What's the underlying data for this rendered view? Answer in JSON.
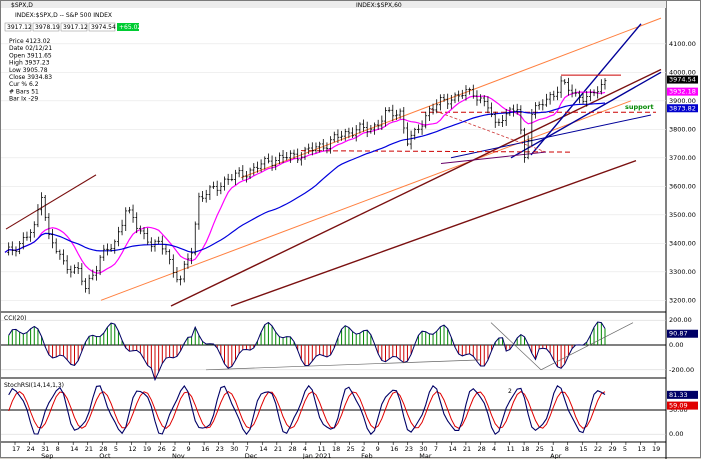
{
  "window": {
    "tab_left": "$SPX,D",
    "tab_right": "INDEX:$SPX,60",
    "title": "INDEX:$SPX,D  --  S&P 500 INDEX"
  },
  "ohlc_bar": {
    "open": "3917.12",
    "high": "3978.19",
    "low": "3917.12",
    "close": "3974.54",
    "change": "+65.02"
  },
  "data_window": [
    "Price   4123.02",
    "Date    02/12/21",
    "Open    3911.65",
    "High    3937.23",
    "Low     3905.78",
    "Close   3934.83",
    "Cur %  6.2",
    "# Bars 51",
    "Bar Ix  -29"
  ],
  "annotations": {
    "support": "support",
    "wave_label": "2"
  },
  "price_scale": {
    "ticks": [
      "4100.00",
      "4000.00",
      "3900.00",
      "3800.00",
      "3700.00",
      "3600.00",
      "3500.00",
      "3400.00",
      "3300.00",
      "3200.00"
    ],
    "badges": [
      {
        "text": "3974.54",
        "bg": "#000000",
        "fg": "#ffffff"
      },
      {
        "text": "3932.18",
        "bg": "#ff00ff",
        "fg": "#ffffff"
      },
      {
        "text": "3873.82",
        "bg": "#0000cc",
        "fg": "#ffffff"
      }
    ]
  },
  "cci_panel": {
    "title": "CCI(20)",
    "ticks": [
      "200.00",
      "0.00",
      "-200.00"
    ],
    "badge": {
      "text": "90.87",
      "bg": "#000066",
      "fg": "#ffffff"
    }
  },
  "stoch_panel": {
    "title": "StochRSI(14,14,1,3)",
    "ticks": [
      "50.00",
      "0.00"
    ],
    "badges": [
      {
        "text": "81.33",
        "bg": "#000066",
        "fg": "#ffffff"
      },
      {
        "text": "59.09",
        "bg": "#e00000",
        "fg": "#ffffff"
      }
    ]
  },
  "x_axis": {
    "ticks": [
      "17",
      "24",
      "31",
      "8",
      "14",
      "21",
      "28",
      "5",
      "12",
      "19",
      "26",
      "2",
      "9",
      "16",
      "23",
      "30",
      "7",
      "14",
      "21",
      "28",
      "4",
      "11",
      "18",
      "25",
      "2",
      "9",
      "16",
      "23",
      "30",
      "7",
      "14",
      "21",
      "28",
      "4",
      "11",
      "18",
      "25",
      "1",
      "8",
      "15",
      "22",
      "29",
      "5",
      "13",
      "19"
    ],
    "months": [
      "Sep",
      "Oct",
      "Nov",
      "Dec",
      "Jan 2021",
      "Feb",
      "Mar",
      "Apr"
    ]
  },
  "chart_data": {
    "type": "candlestick",
    "title": "INDEX:$SPX,D -- S&P 500 INDEX",
    "ylim": [
      3180,
      4180
    ],
    "x_months": [
      "Sep",
      "Oct",
      "Nov",
      "Dec",
      "Jan 2021",
      "Feb",
      "Mar",
      "Apr"
    ],
    "approx_close": [
      [
        0,
        3360
      ],
      [
        4,
        3400
      ],
      [
        8,
        3450
      ],
      [
        10,
        3580
      ],
      [
        12,
        3420
      ],
      [
        16,
        3330
      ],
      [
        20,
        3300
      ],
      [
        22,
        3240
      ],
      [
        26,
        3350
      ],
      [
        30,
        3400
      ],
      [
        33,
        3520
      ],
      [
        36,
        3460
      ],
      [
        40,
        3400
      ],
      [
        44,
        3380
      ],
      [
        46,
        3300
      ],
      [
        48,
        3270
      ],
      [
        51,
        3380
      ],
      [
        53,
        3560
      ],
      [
        56,
        3580
      ],
      [
        60,
        3620
      ],
      [
        64,
        3640
      ],
      [
        68,
        3660
      ],
      [
        72,
        3690
      ],
      [
        76,
        3700
      ],
      [
        80,
        3710
      ],
      [
        84,
        3730
      ],
      [
        88,
        3750
      ],
      [
        92,
        3780
      ],
      [
        96,
        3800
      ],
      [
        100,
        3800
      ],
      [
        104,
        3850
      ],
      [
        108,
        3860
      ],
      [
        110,
        3760
      ],
      [
        112,
        3780
      ],
      [
        116,
        3870
      ],
      [
        120,
        3900
      ],
      [
        124,
        3920
      ],
      [
        128,
        3930
      ],
      [
        132,
        3880
      ],
      [
        134,
        3810
      ],
      [
        136,
        3850
      ],
      [
        140,
        3870
      ],
      [
        142,
        3700
      ],
      [
        144,
        3860
      ],
      [
        148,
        3900
      ],
      [
        152,
        3960
      ],
      [
        156,
        3920
      ],
      [
        160,
        3910
      ],
      [
        164,
        3970
      ]
    ],
    "series": [
      {
        "name": "CCI(20) last",
        "values": [
          90.87
        ]
      },
      {
        "name": "StochRSI last",
        "values": [
          81.33
        ]
      }
    ]
  }
}
